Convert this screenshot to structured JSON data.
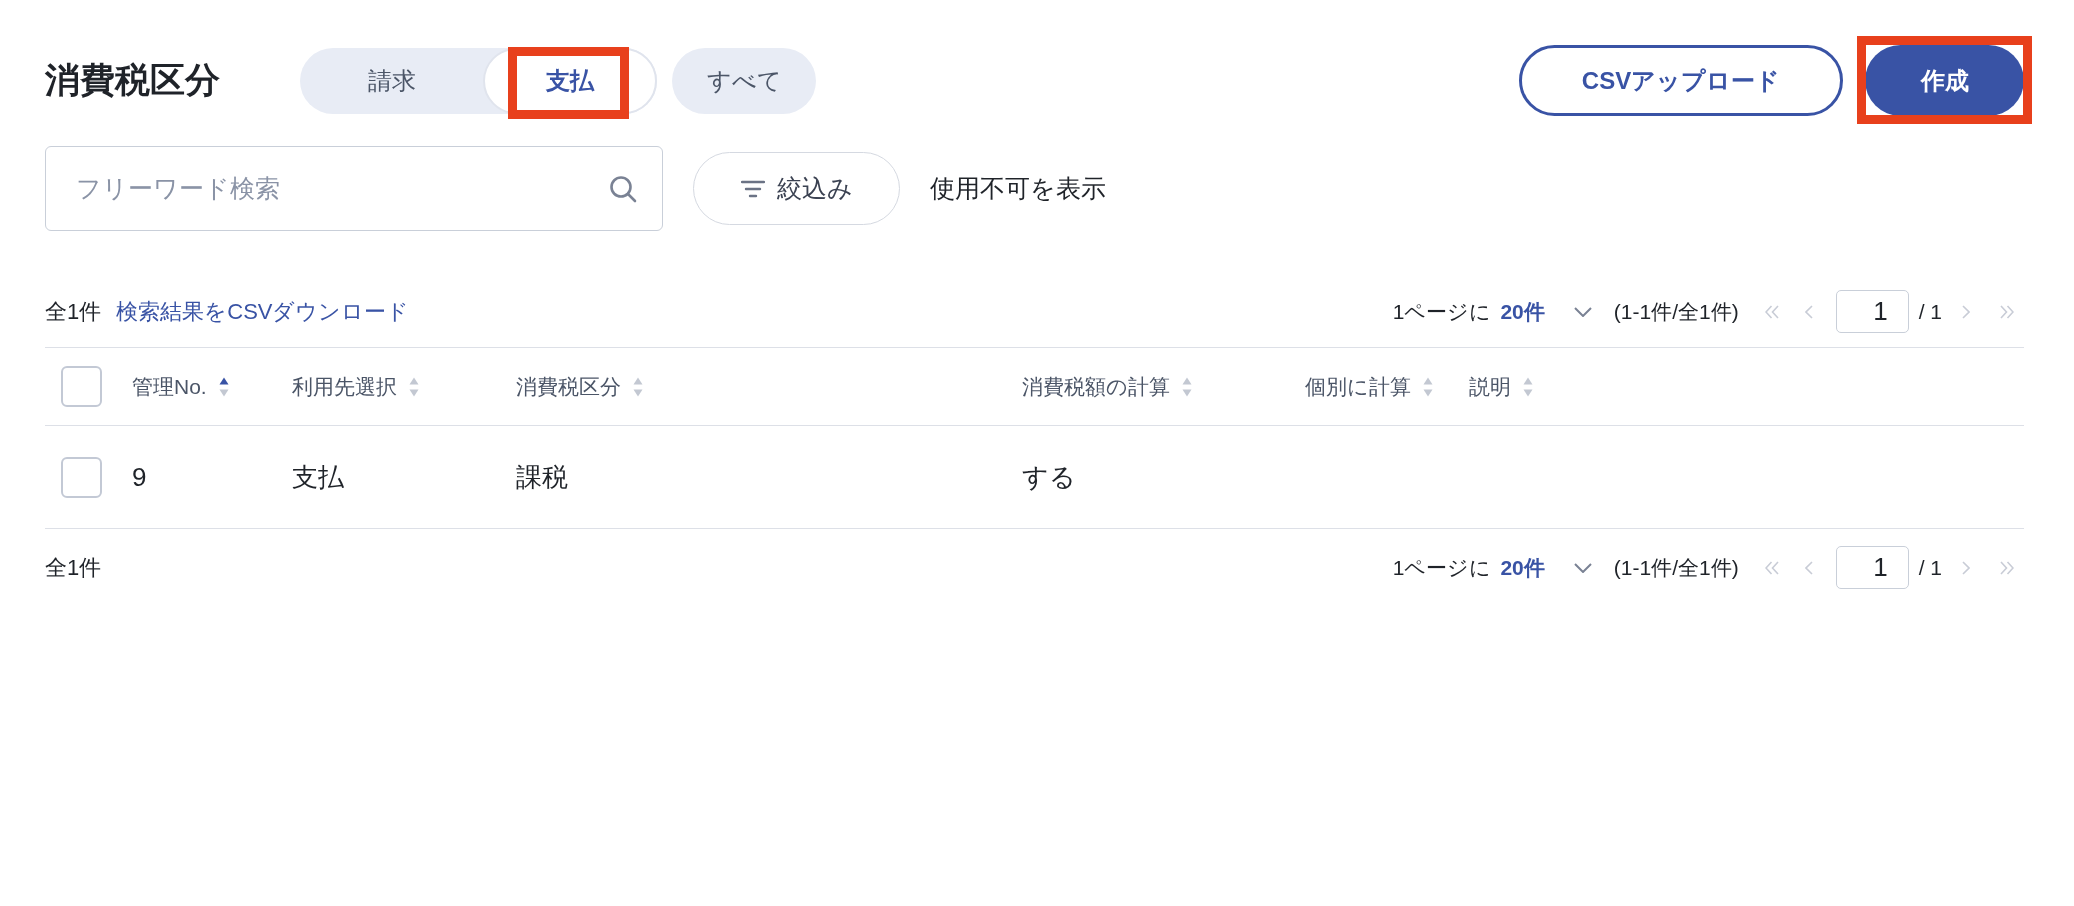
{
  "header": {
    "title": "消費税区分"
  },
  "tabs": [
    {
      "label": "請求",
      "selected": false,
      "highlighted": false
    },
    {
      "label": "支払",
      "selected": true,
      "highlighted": true
    }
  ],
  "all_button": {
    "label": "すべて",
    "selected": false
  },
  "actions": [
    {
      "label": "CSVアップロード",
      "kind": "outline",
      "highlighted": false
    },
    {
      "label": "作成",
      "kind": "primary",
      "highlighted": true
    }
  ],
  "search": {
    "placeholder": "フリーワード検索"
  },
  "filter_button": {
    "label": "絞込み"
  },
  "show_unavailable": {
    "label": "使用不可を表示"
  },
  "summary_top": {
    "count": "全1件",
    "download_link": "検索結果をCSVダウンロード"
  },
  "pagination_top": {
    "per_page_prefix": "1ページに",
    "per_page": "20件",
    "range": "(1-1件/全1件)",
    "page": "1",
    "total_pages": "/ 1",
    "prev_disabled": true,
    "next_disabled": true
  },
  "table": {
    "header_checkbox": {
      "checked": false
    },
    "columns": [
      {
        "label": "管理No.",
        "sorted_ascending": true
      },
      {
        "label": "利用先選択",
        "sorted_ascending": false
      },
      {
        "label": "消費税区分",
        "sorted_ascending": false
      },
      {
        "label": "消費税額の計算",
        "sorted_ascending": false
      },
      {
        "label": "個別に計算",
        "sorted_ascending": false
      },
      {
        "label": "説明",
        "sorted_ascending": false
      }
    ],
    "rows": [
      {
        "checked": false,
        "cells": [
          "9",
          "支払",
          "課税",
          "する"
        ]
      }
    ]
  },
  "summary_bottom": {
    "count": "全1件"
  },
  "pagination_bottom": {
    "per_page_prefix": "1ページに",
    "per_page": "20件",
    "range": "(1-1件/全1件)",
    "page": "1",
    "total_pages": "/ 1",
    "prev_disabled": true,
    "next_disabled": true
  }
}
